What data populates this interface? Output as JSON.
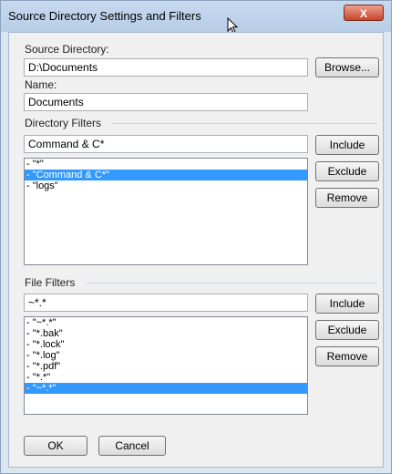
{
  "window": {
    "title": "Source Directory Settings and Filters",
    "close_label": "X"
  },
  "source": {
    "label": "Source Directory:",
    "value": "D:\\Documents",
    "browse_label": "Browse..."
  },
  "name": {
    "label": "Name:",
    "value": "Documents"
  },
  "directory_filters": {
    "header": "Directory Filters",
    "input_value": "Command & C*",
    "include_label": "Include",
    "exclude_label": "Exclude",
    "remove_label": "Remove",
    "items": [
      "- \"*\"",
      "- \"Command & C*\"",
      "- \"logs\""
    ],
    "selected_index": 1
  },
  "file_filters": {
    "header": "File Filters",
    "input_value": "~*.*",
    "include_label": "Include",
    "exclude_label": "Exclude",
    "remove_label": "Remove",
    "items": [
      "- \"~*.*\"",
      "- \"*.bak\"",
      "- \"*.lock\"",
      "- \"*.log\"",
      "- \"*.pdf\"",
      "- \"*.*\"",
      "- \"~*.*\""
    ],
    "selected_index": 6
  },
  "footer": {
    "ok_label": "OK",
    "cancel_label": "Cancel"
  }
}
